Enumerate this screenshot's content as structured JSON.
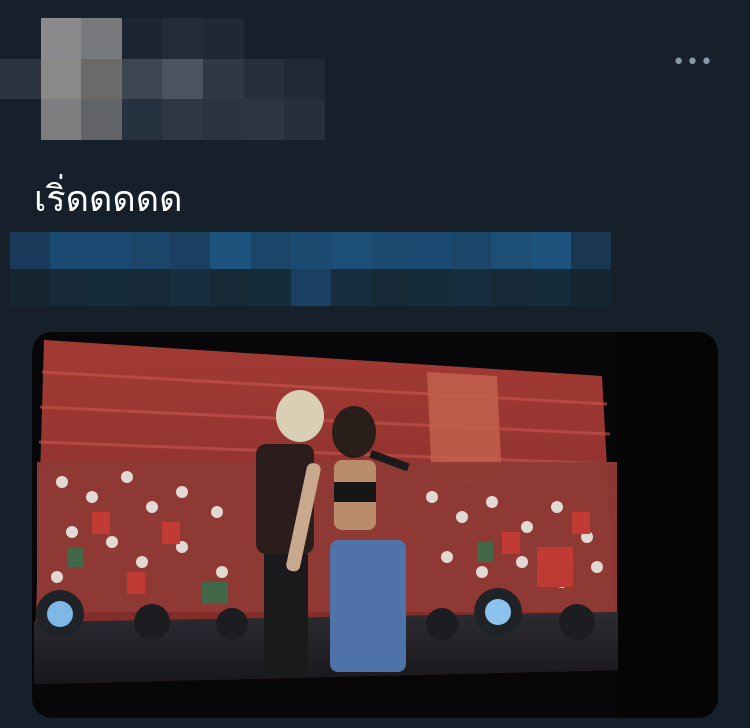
{
  "tweet": {
    "text": "เริ่ดดดดด",
    "more_label": "•••"
  },
  "colors": {
    "background": "#15202b",
    "text": "#ffffff",
    "muted": "#8899a6",
    "stage_red": "#b8322e"
  }
}
